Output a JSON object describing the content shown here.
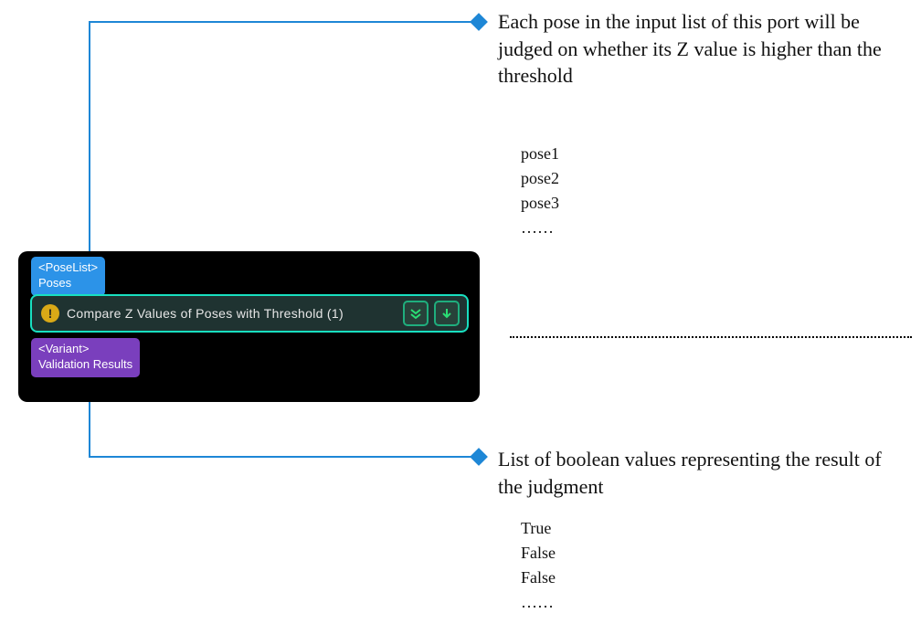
{
  "node": {
    "input_port": {
      "type": "<PoseList>",
      "name": "Poses"
    },
    "step": {
      "title": "Compare Z Values of Poses with Threshold (1)",
      "warn_glyph": "!"
    },
    "output_port": {
      "type": "<Variant>",
      "name": "Validation Results"
    }
  },
  "annotation_top": {
    "description": "Each pose in the input list of this port will be judged on whether its Z value is higher than the threshold",
    "list": [
      "pose1",
      "pose2",
      "pose3",
      "……"
    ]
  },
  "annotation_bottom": {
    "description": "List of boolean values representing the result of the judgment",
    "list": [
      "True",
      "False",
      "False",
      "……"
    ]
  }
}
